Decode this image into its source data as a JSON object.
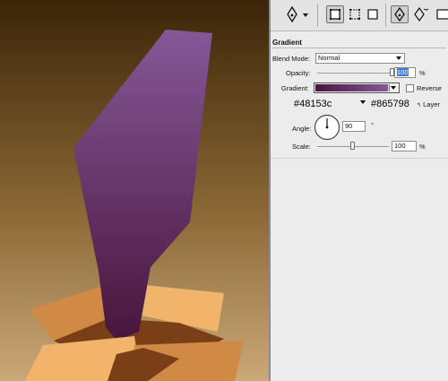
{
  "canvas": {
    "colors": {
      "background_top": "#3b2508",
      "background_bottom": "#caa878",
      "shape_top": "#865798",
      "shape_bottom": "#48153c",
      "box_light": "#f1b46a",
      "box_mid": "#d08a45",
      "box_dark": "#7a3f16"
    }
  },
  "toolbar": {
    "icons": [
      "pen-tool-icon",
      "dropdown-arrow-icon",
      "shape-layers-icon",
      "paths-icon",
      "fill-pixels-icon",
      "pen-icon",
      "freeform-pen-icon",
      "rectangle-icon"
    ]
  },
  "gradient_panel": {
    "title": "Gradient",
    "blend_mode_label": "Blend Mode:",
    "blend_mode_value": "Normal",
    "opacity_label": "Opacity:",
    "opacity_value": "100",
    "opacity_unit": "%",
    "opacity_level": 1.0,
    "gradient_label": "Gradient:",
    "gradient_start": "#48153c",
    "gradient_end": "#865798",
    "reverse_label": "Reverse",
    "reverse_checked": false,
    "stop_start_label": "#48153c",
    "stop_end_label": "#865798",
    "align_layer_label": "Layer",
    "angle_label": "Angle:",
    "angle_value": "90",
    "angle_unit": "°",
    "scale_label": "Scale:",
    "scale_value": "100",
    "scale_unit": "%",
    "scale_level": 0.5
  }
}
